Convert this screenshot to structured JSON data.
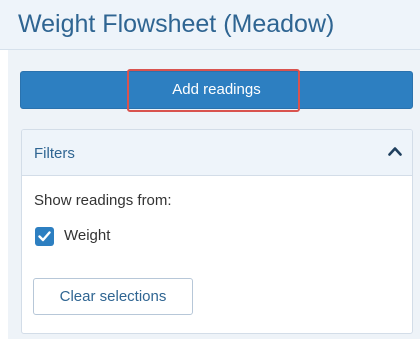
{
  "header": {
    "title": "Weight Flowsheet (Meadow)"
  },
  "toolbar": {
    "add_readings_label": "Add readings"
  },
  "filters": {
    "title": "Filters",
    "expanded": true,
    "show_from_label": "Show readings from:",
    "options": [
      {
        "label": "Weight",
        "checked": true
      }
    ],
    "clear_label": "Clear selections"
  },
  "colors": {
    "accent": "#2d7fc1",
    "title_text": "#2f6592",
    "highlight": "#d9534f",
    "panel_bg": "#eef3f8"
  },
  "icons": {
    "collapse": "chevron-up-icon",
    "checkbox": "check-icon"
  }
}
